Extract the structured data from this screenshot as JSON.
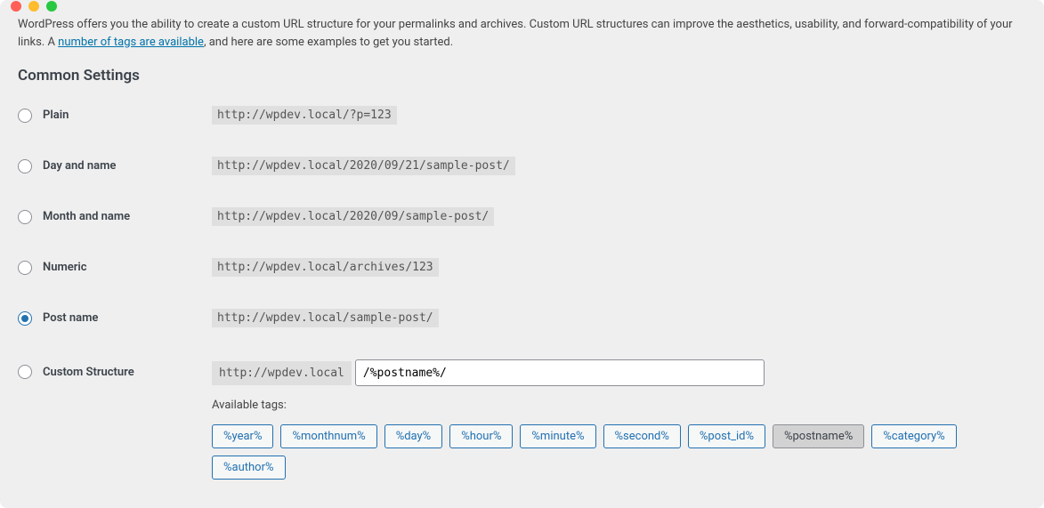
{
  "intro": {
    "text_before": "WordPress offers you the ability to create a custom URL structure for your permalinks and archives. Custom URL structures can improve the aesthetics, usability, and forward-compatibility of your links. A ",
    "link_text": "number of tags are available",
    "text_after": ", and here are some examples to get you started."
  },
  "section_title": "Common Settings",
  "options": {
    "plain": {
      "label": "Plain",
      "example": "http://wpdev.local/?p=123"
    },
    "day_name": {
      "label": "Day and name",
      "example": "http://wpdev.local/2020/09/21/sample-post/"
    },
    "month_name": {
      "label": "Month and name",
      "example": "http://wpdev.local/2020/09/sample-post/"
    },
    "numeric": {
      "label": "Numeric",
      "example": "http://wpdev.local/archives/123"
    },
    "post_name": {
      "label": "Post name",
      "example": "http://wpdev.local/sample-post/"
    },
    "custom": {
      "label": "Custom Structure",
      "prefix": "http://wpdev.local",
      "value": "/%postname%/"
    }
  },
  "available_tags_label": "Available tags:",
  "tags": [
    "%year%",
    "%monthnum%",
    "%day%",
    "%hour%",
    "%minute%",
    "%second%",
    "%post_id%",
    "%postname%",
    "%category%",
    "%author%"
  ],
  "active_tag": "%postname%"
}
